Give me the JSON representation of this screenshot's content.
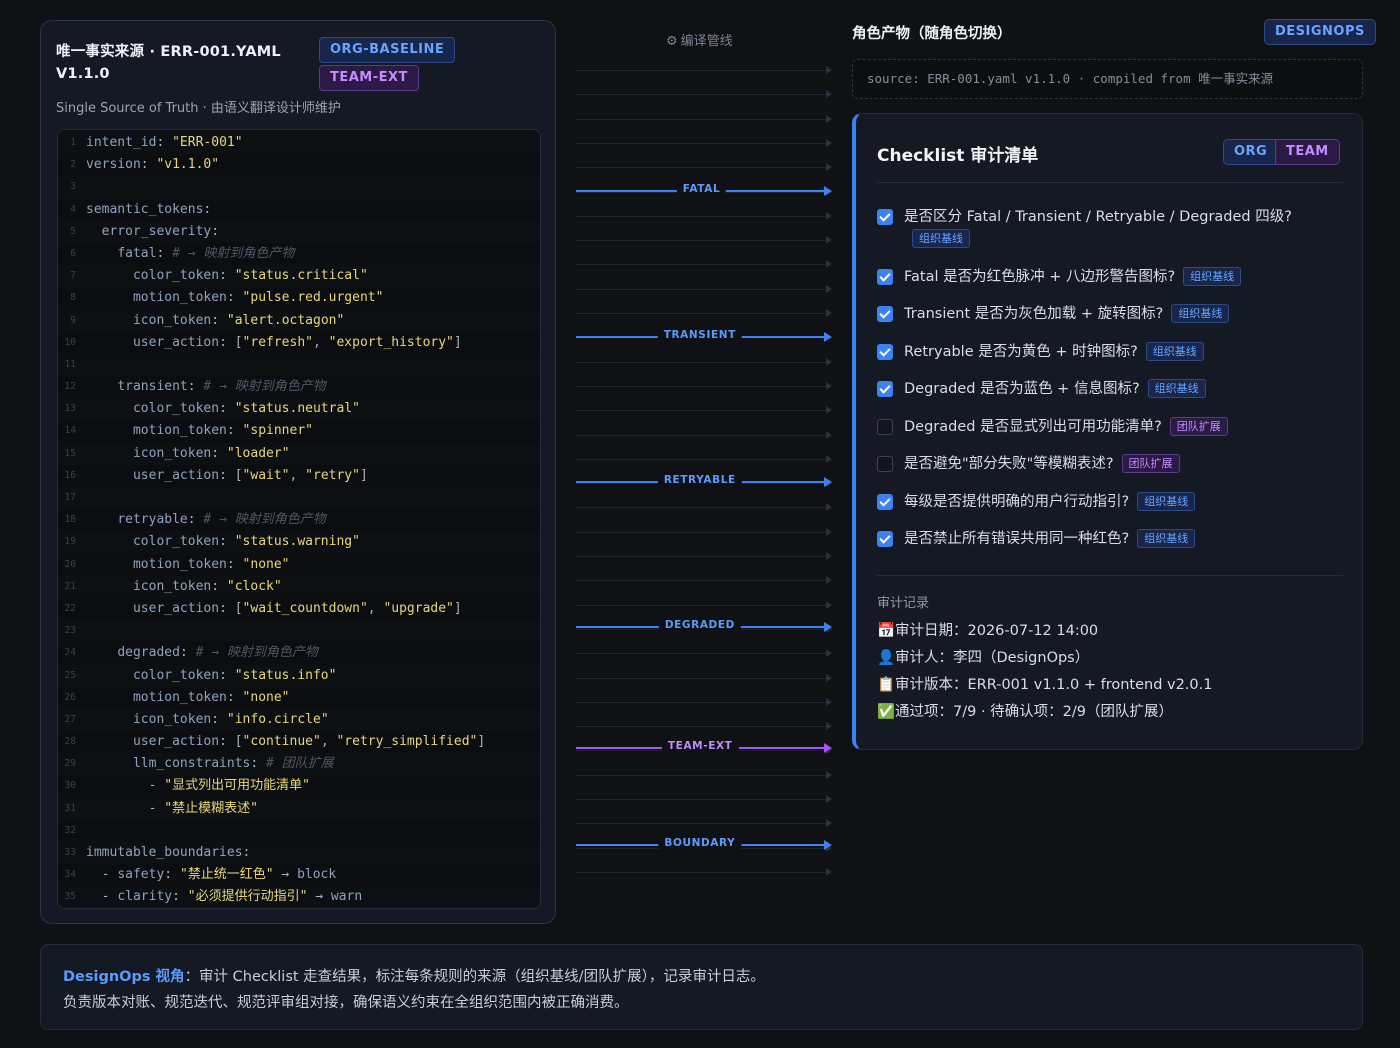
{
  "source": {
    "title": "唯一事实来源 · ERR-001.YAML V1.1.0",
    "tag_org": "ORG-BASELINE",
    "tag_team": "TEAM-EXT",
    "subtitle": "Single Source of Truth · 由语义翻译设计师维护",
    "code_lines": [
      [
        [
          "k",
          "intent_id"
        ],
        [
          "p",
          ": "
        ],
        [
          "s",
          "\"ERR-001\""
        ]
      ],
      [
        [
          "k",
          "version"
        ],
        [
          "p",
          ": "
        ],
        [
          "s",
          "\"v1.1.0\""
        ]
      ],
      [],
      [
        [
          "k",
          "semantic_tokens"
        ],
        [
          "p",
          ":"
        ]
      ],
      [
        [
          "p",
          "  "
        ],
        [
          "k",
          "error_severity"
        ],
        [
          "p",
          ":"
        ]
      ],
      [
        [
          "p",
          "    "
        ],
        [
          "k",
          "fatal"
        ],
        [
          "p",
          ": "
        ],
        [
          "c",
          "# → 映射到角色产物"
        ]
      ],
      [
        [
          "p",
          "      "
        ],
        [
          "k",
          "color_token"
        ],
        [
          "p",
          ": "
        ],
        [
          "s",
          "\"status.critical\""
        ]
      ],
      [
        [
          "p",
          "      "
        ],
        [
          "k",
          "motion_token"
        ],
        [
          "p",
          ": "
        ],
        [
          "s",
          "\"pulse.red.urgent\""
        ]
      ],
      [
        [
          "p",
          "      "
        ],
        [
          "k",
          "icon_token"
        ],
        [
          "p",
          ": "
        ],
        [
          "s",
          "\"alert.octagon\""
        ]
      ],
      [
        [
          "p",
          "      "
        ],
        [
          "k",
          "user_action"
        ],
        [
          "p",
          ": ["
        ],
        [
          "s",
          "\"refresh\""
        ],
        [
          "p",
          ", "
        ],
        [
          "s",
          "\"export_history\""
        ],
        [
          "p",
          "]"
        ]
      ],
      [],
      [
        [
          "p",
          "    "
        ],
        [
          "k",
          "transient"
        ],
        [
          "p",
          ": "
        ],
        [
          "c",
          "# → 映射到角色产物"
        ]
      ],
      [
        [
          "p",
          "      "
        ],
        [
          "k",
          "color_token"
        ],
        [
          "p",
          ": "
        ],
        [
          "s",
          "\"status.neutral\""
        ]
      ],
      [
        [
          "p",
          "      "
        ],
        [
          "k",
          "motion_token"
        ],
        [
          "p",
          ": "
        ],
        [
          "s",
          "\"spinner\""
        ]
      ],
      [
        [
          "p",
          "      "
        ],
        [
          "k",
          "icon_token"
        ],
        [
          "p",
          ": "
        ],
        [
          "s",
          "\"loader\""
        ]
      ],
      [
        [
          "p",
          "      "
        ],
        [
          "k",
          "user_action"
        ],
        [
          "p",
          ": ["
        ],
        [
          "s",
          "\"wait\""
        ],
        [
          "p",
          ", "
        ],
        [
          "s",
          "\"retry\""
        ],
        [
          "p",
          "]"
        ]
      ],
      [],
      [
        [
          "p",
          "    "
        ],
        [
          "k",
          "retryable"
        ],
        [
          "p",
          ": "
        ],
        [
          "c",
          "# → 映射到角色产物"
        ]
      ],
      [
        [
          "p",
          "      "
        ],
        [
          "k",
          "color_token"
        ],
        [
          "p",
          ": "
        ],
        [
          "s",
          "\"status.warning\""
        ]
      ],
      [
        [
          "p",
          "      "
        ],
        [
          "k",
          "motion_token"
        ],
        [
          "p",
          ": "
        ],
        [
          "s",
          "\"none\""
        ]
      ],
      [
        [
          "p",
          "      "
        ],
        [
          "k",
          "icon_token"
        ],
        [
          "p",
          ": "
        ],
        [
          "s",
          "\"clock\""
        ]
      ],
      [
        [
          "p",
          "      "
        ],
        [
          "k",
          "user_action"
        ],
        [
          "p",
          ": ["
        ],
        [
          "s",
          "\"wait_countdown\""
        ],
        [
          "p",
          ", "
        ],
        [
          "s",
          "\"upgrade\""
        ],
        [
          "p",
          "]"
        ]
      ],
      [],
      [
        [
          "p",
          "    "
        ],
        [
          "k",
          "degraded"
        ],
        [
          "p",
          ": "
        ],
        [
          "c",
          "# → 映射到角色产物"
        ]
      ],
      [
        [
          "p",
          "      "
        ],
        [
          "k",
          "color_token"
        ],
        [
          "p",
          ": "
        ],
        [
          "s",
          "\"status.info\""
        ]
      ],
      [
        [
          "p",
          "      "
        ],
        [
          "k",
          "motion_token"
        ],
        [
          "p",
          ": "
        ],
        [
          "s",
          "\"none\""
        ]
      ],
      [
        [
          "p",
          "      "
        ],
        [
          "k",
          "icon_token"
        ],
        [
          "p",
          ": "
        ],
        [
          "s",
          "\"info.circle\""
        ]
      ],
      [
        [
          "p",
          "      "
        ],
        [
          "k",
          "user_action"
        ],
        [
          "p",
          ": ["
        ],
        [
          "s",
          "\"continue\""
        ],
        [
          "p",
          ", "
        ],
        [
          "s",
          "\"retry_simplified\""
        ],
        [
          "p",
          "]"
        ]
      ],
      [
        [
          "p",
          "      "
        ],
        [
          "k",
          "llm_constraints"
        ],
        [
          "p",
          ": "
        ],
        [
          "c",
          "# 团队扩展"
        ]
      ],
      [
        [
          "p",
          "        - "
        ],
        [
          "s",
          "\"显式列出可用功能清单\""
        ]
      ],
      [
        [
          "p",
          "        - "
        ],
        [
          "s",
          "\"禁止模糊表述\""
        ]
      ],
      [],
      [
        [
          "k",
          "immutable_boundaries"
        ],
        [
          "p",
          ":"
        ]
      ],
      [
        [
          "p",
          "  - "
        ],
        [
          "k",
          "safety"
        ],
        [
          "p",
          ": "
        ],
        [
          "s",
          "\"禁止统一红色\""
        ],
        [
          "p",
          " → "
        ],
        [
          "k",
          "block"
        ]
      ],
      [
        [
          "p",
          "  - "
        ],
        [
          "k",
          "clarity"
        ],
        [
          "p",
          ": "
        ],
        [
          "s",
          "\"必须提供行动指引\""
        ],
        [
          "p",
          " → "
        ],
        [
          "k",
          "warn"
        ]
      ]
    ]
  },
  "pipeline": {
    "title": "编译管线",
    "gear_icon": "⚙",
    "flows": [
      {
        "label": "FATAL",
        "color": "blue"
      },
      {
        "label": "TRANSIENT",
        "color": "blue"
      },
      {
        "label": "RETRYABLE",
        "color": "blue"
      },
      {
        "label": "DEGRADED",
        "color": "blue"
      },
      {
        "label": "TEAM-EXT",
        "color": "purple"
      },
      {
        "label": "BOUNDARY",
        "color": "blue"
      }
    ]
  },
  "artifacts": {
    "title": "角色产物（随角色切换）",
    "role_badge": "DESIGNOPS",
    "source_line": "source: ERR-001.yaml v1.1.0 · compiled from 唯一事实来源"
  },
  "checklist": {
    "title": "Checklist 审计清单",
    "seg_org": "ORG",
    "seg_team": "TEAM",
    "items": [
      {
        "checked": true,
        "text": "是否区分 Fatal / Transient / Retryable / Degraded 四级?",
        "badge": "组织基线",
        "scope": "org"
      },
      {
        "checked": true,
        "text": "Fatal 是否为红色脉冲 + 八边形警告图标?",
        "badge": "组织基线",
        "scope": "org"
      },
      {
        "checked": true,
        "text": "Transient 是否为灰色加载 + 旋转图标?",
        "badge": "组织基线",
        "scope": "org"
      },
      {
        "checked": true,
        "text": "Retryable 是否为黄色 + 时钟图标?",
        "badge": "组织基线",
        "scope": "org"
      },
      {
        "checked": true,
        "text": "Degraded 是否为蓝色 + 信息图标?",
        "badge": "组织基线",
        "scope": "org"
      },
      {
        "checked": false,
        "text": "Degraded 是否显式列出可用功能清单?",
        "badge": "团队扩展",
        "scope": "team"
      },
      {
        "checked": false,
        "text": "是否避免\"部分失败\"等模糊表述?",
        "badge": "团队扩展",
        "scope": "team"
      },
      {
        "checked": true,
        "text": "每级是否提供明确的用户行动指引?",
        "badge": "组织基线",
        "scope": "org"
      },
      {
        "checked": true,
        "text": "是否禁止所有错误共用同一种红色?",
        "badge": "组织基线",
        "scope": "org"
      }
    ],
    "audit_heading": "审计记录",
    "audit": {
      "date_icon": "📅",
      "date": "审计日期：2026-07-12 14:00",
      "user_icon": "👤",
      "user": "审计人：李四（DesignOps）",
      "version_icon": "📋",
      "version": "审计版本：ERR-001 v1.1.0 + frontend v2.0.1",
      "pass_icon": "✅",
      "pass": "通过项：7/9 · 待确认项：2/9（团队扩展）"
    }
  },
  "footer": {
    "highlight": "DesignOps 视角",
    "line1": "：审计 Checklist 走查结果，标注每条规则的来源（组织基线/团队扩展），记录审计日志。",
    "line2": "负责版本对账、规范迭代、规范评审组对接，确保语义约束在全组织范围内被正确消费。"
  }
}
